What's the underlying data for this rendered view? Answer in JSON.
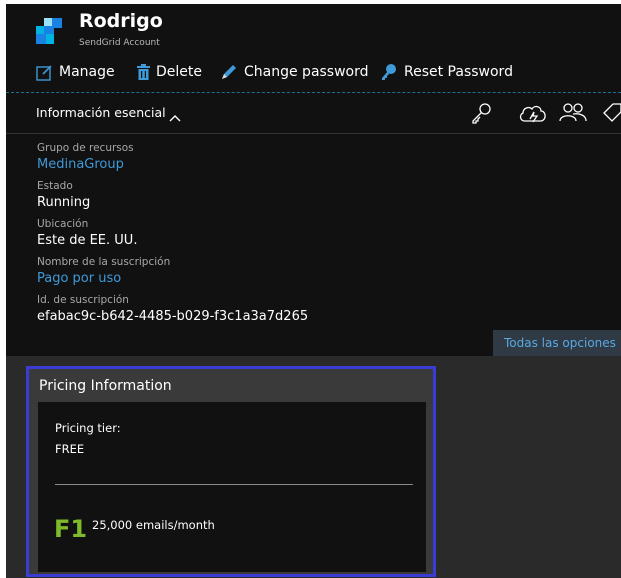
{
  "header": {
    "title": "Rodrigo",
    "subtitle": "SendGrid Account",
    "logo_colors": [
      "#1a82e2",
      "#99e1f4",
      "#00b3e3",
      "#263746"
    ]
  },
  "toolbar": {
    "manage_label": "Manage",
    "delete_label": "Delete",
    "change_password_label": "Change password",
    "reset_password_label": "Reset Password"
  },
  "essentials": {
    "label": "Información esencial",
    "icons": [
      "key-icon",
      "cloud-icon",
      "users-icon",
      "tag-icon"
    ]
  },
  "info": {
    "resource_group_label": "Grupo de recursos",
    "resource_group_value": "MedinaGroup",
    "status_label": "Estado",
    "status_value": "Running",
    "location_label": "Ubicación",
    "location_value": "Este de EE. UU.",
    "subscription_name_label": "Nombre de la suscripción",
    "subscription_name_value": "Pago por uso",
    "subscription_id_label": "Id. de suscripción",
    "subscription_id_value": "efabac9c-b642-4485-b029-f3c1a3a7d265",
    "all_options_label": "Todas las opciones"
  },
  "pricing": {
    "title": "Pricing Information",
    "tier_label": "Pricing tier:",
    "tier_value": "FREE",
    "tier_code": "F1",
    "tier_description": "25,000 emails/month"
  },
  "colors": {
    "accent_link": "#3e9ad8",
    "highlight_border": "#3b3bd6",
    "tier_green": "#7fba2c"
  }
}
